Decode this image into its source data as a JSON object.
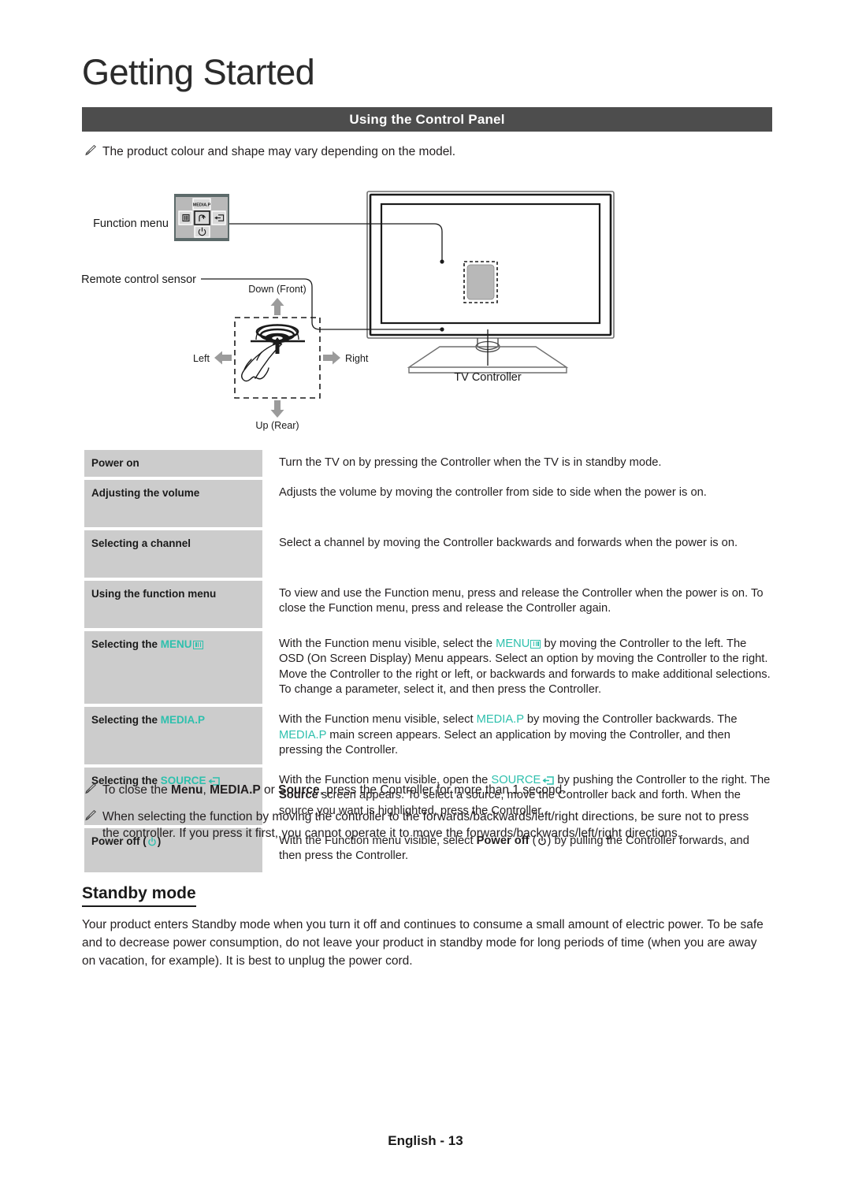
{
  "page": {
    "chapter_title": "Getting Started",
    "section_title": "Using the Control Panel",
    "footer": "English - 13",
    "accent_color": "#2ec0ad",
    "section_bar_color": "#4d4d4d",
    "cell_color": "#cccccc"
  },
  "notes": {
    "top": "The product colour and shape may vary depending on the model.",
    "pen_icon": "pencil-note-icon",
    "bottom_1_parts": {
      "p1": "To close the ",
      "b1": "Menu",
      "p2": ", ",
      "b2": "MEDIA.P",
      "p3": " or ",
      "b3": "Source",
      "p4": ", press the Controller for more than 1 second."
    },
    "bottom_2": "When selecting the function by moving the controller to the forwards/backwards/left/right directions, be sure not to press the controller. If you press it first, you cannot operate it to move the forwards/backwards/left/right directions."
  },
  "diagram": {
    "function_menu_label": "Function menu",
    "remote_sensor_label": "Remote control sensor",
    "tv_controller_label": "TV Controller",
    "panel_buttons": {
      "top": "MEDIA.P",
      "left_icon": "menu-bars-icon",
      "center_icon": "return-arrow-icon",
      "right_icon": "source-input-icon",
      "bottom_icon": "power-icon"
    },
    "directions": {
      "down": "Down (Front)",
      "up": "Up (Rear)",
      "left": "Left",
      "right": "Right"
    }
  },
  "table": {
    "rows": [
      {
        "label_plain": "Power on",
        "label_accent": "",
        "label_icon": "",
        "desc_html": "Turn the TV on by pressing the Controller when the TV is in standby mode."
      },
      {
        "label_plain": "Adjusting the volume",
        "label_accent": "",
        "label_icon": "",
        "desc_html": "Adjusts the volume by moving the controller from side to side when the power is on."
      },
      {
        "label_plain": "Selecting a channel",
        "label_accent": "",
        "label_icon": "",
        "desc_html": "Select a channel by moving the Controller backwards and forwards when the power is on."
      },
      {
        "label_plain": "Using the function menu",
        "label_accent": "",
        "label_icon": "",
        "desc_html": "To view and use the Function menu, press and release the Controller when the power is on. To close the Function menu, press and release the Controller again."
      },
      {
        "label_plain": "Selecting the ",
        "label_accent": "MENU",
        "label_icon": "menu-bars-icon",
        "desc_html": "With the Function menu visible, select the MENU by moving the Controller to the left. The OSD (On Screen Display) Menu appears. Select an option by moving the Controller to the right. Move the Controller to the right or left, or backwards and forwards to make additional selections. To change a parameter, select it, and then press the Controller."
      },
      {
        "label_plain": "Selecting the ",
        "label_accent": "MEDIA.P",
        "label_icon": "",
        "desc_html": "With the Function menu visible, select MEDIA.P by moving the Controller backwards. The MEDIA.P main screen appears. Select an application by moving the Controller, and then pressing the Controller."
      },
      {
        "label_plain": "Selecting the ",
        "label_accent": "SOURCE",
        "label_icon": "source-input-icon",
        "desc_html": "With the Function menu visible, open the SOURCE by pushing the Controller to the right. The Source screen appears. To select a source, move the Controller back and forth. When the source you want is highlighted, press the Controller."
      },
      {
        "label_plain": "Power off ",
        "label_accent": "",
        "label_icon": "power-icon",
        "desc_html": "With the Function menu visible, select Power off by pulling the Controller forwards, and then press the Controller."
      }
    ],
    "row_fragments": {
      "r5": {
        "a": "With the Function menu visible, select the ",
        "menu": "MENU",
        "b": " by moving the Controller to the left. The OSD (On Screen Display) Menu appears. Select an option by moving the Controller to the right. Move the Controller to the right or left, or backwards and forwards to make additional selections. To change a parameter, select it, and then press the Controller."
      },
      "r6": {
        "a": "With the Function menu visible, select ",
        "m1": "MEDIA.P",
        "b": " by moving the Controller backwards. The ",
        "m2": "MEDIA.P",
        "c": " main screen appears. Select an application by moving the Controller, and then pressing the Controller."
      },
      "r7": {
        "a": "With the Function menu visible, open the ",
        "src": "SOURCE",
        "b": " by pushing the Controller to the right. The ",
        "bold": "Source",
        "c": " screen appears. To select a source, move the Controller back and forth. When the source you want is highlighted, press the Controller."
      },
      "r8": {
        "a": "With the Function menu visible, select ",
        "bold": "Power off",
        "b": " (",
        "c": ") by pulling the Controller forwards, and then press the Controller."
      }
    }
  },
  "standby": {
    "heading": "Standby mode",
    "body": "Your product enters Standby mode when you turn it off and continues to consume a small amount of electric power. To be safe and to decrease power consumption, do not leave your product in standby mode for long periods of time (when you are away on vacation, for example). It is best to unplug the power cord."
  }
}
